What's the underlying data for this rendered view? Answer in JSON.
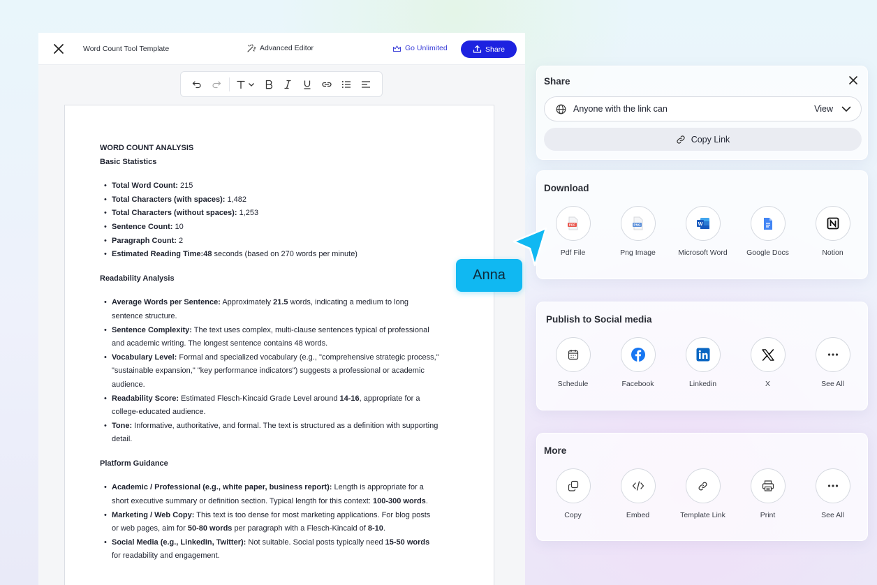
{
  "editor": {
    "doc_title": "Word Count Tool Template",
    "advanced_editor": "Advanced Editor",
    "go_unlimited": "Go Unlimited",
    "share": "Share"
  },
  "doc": {
    "title": "WORD COUNT ANALYSIS",
    "s1": {
      "heading": "Basic Statistics",
      "items": [
        {
          "b": "Total Word Count:",
          "t": " 215"
        },
        {
          "b": "Total Characters (with spaces):",
          "t": " 1,482"
        },
        {
          "b": "Total Characters (without spaces):",
          "t": " 1,253"
        },
        {
          "b": "Sentence Count:",
          "t": " 10"
        },
        {
          "b": "Paragraph Count:",
          "t": " 2"
        },
        {
          "b": "Estimated Reading Time:",
          "b2": "48",
          "t": " seconds (based on 270 words per minute)"
        }
      ]
    },
    "s2": {
      "heading": "Readability Analysis",
      "items": [
        {
          "b": "Average Words per Sentence:",
          "t1": " Approximately ",
          "b2": "21.5",
          "t2": " words, indicating a medium to long sentence structure."
        },
        {
          "b": "Sentence Complexity:",
          "t": " The text uses complex, multi-clause sentences typical of professional and academic writing. The longest sentence contains 48 words."
        },
        {
          "b": "Vocabulary Level:",
          "t": " Formal and specialized vocabulary (e.g., \"comprehensive strategic process,\" \"sustainable expansion,\" \"key performance indicators\") suggests a professional or academic audience."
        },
        {
          "b": "Readability Score:",
          "t1": " Estimated Flesch-Kincaid Grade Level around ",
          "b2": "14-16",
          "t2": ", appropriate for a college-educated audience."
        },
        {
          "b": "Tone:",
          "t": " Informative, authoritative, and formal. The text is structured as a definition with supporting detail."
        }
      ]
    },
    "s3": {
      "heading": "Platform Guidance",
      "items": [
        {
          "b": "Academic / Professional (e.g., white paper, business report):",
          "t1": " Length is appropriate for a short executive summary or definition section. Typical length for this context: ",
          "b2": "100-300 words",
          "t2": "."
        },
        {
          "b": "Marketing / Web Copy:",
          "t1": " This text is too dense for most marketing applications. For blog posts or web pages, aim for ",
          "b2": "50-80 words",
          "t2": " per paragraph with a Flesch-Kincaid of ",
          "b3": "8-10",
          "t3": "."
        },
        {
          "b": "Social Media (e.g., LinkedIn, Twitter):",
          "t1": " Not suitable. Social posts typically need ",
          "b2": "15-50 words",
          "t2": " for readability and engagement."
        }
      ]
    }
  },
  "share_panel": {
    "title": "Share",
    "permission": "Anyone with the link can",
    "permission_value": "View",
    "copy_link": "Copy Link"
  },
  "download": {
    "title": "Download",
    "items": [
      {
        "label": "Pdf File",
        "icon": "pdf-icon"
      },
      {
        "label": "Png Image",
        "icon": "png-icon"
      },
      {
        "label": "Microsoft Word",
        "icon": "microsoft-word-icon"
      },
      {
        "label": "Google Docs",
        "icon": "google-docs-icon"
      },
      {
        "label": "Notion",
        "icon": "notion-icon"
      }
    ]
  },
  "social": {
    "title": "Publish to Social media",
    "items": [
      {
        "label": "Schedule",
        "icon": "calendar-icon"
      },
      {
        "label": "Facebook",
        "icon": "facebook-icon"
      },
      {
        "label": "Linkedin",
        "icon": "linkedin-icon"
      },
      {
        "label": "X",
        "icon": "x-logo-icon"
      },
      {
        "label": "See All",
        "icon": "more-icon"
      }
    ]
  },
  "more": {
    "title": "More",
    "items": [
      {
        "label": "Copy",
        "icon": "copy-icon"
      },
      {
        "label": "Embed",
        "icon": "code-icon"
      },
      {
        "label": "Template Link",
        "icon": "link-icon"
      },
      {
        "label": "Print",
        "icon": "printer-icon"
      },
      {
        "label": "See All",
        "icon": "more-icon"
      }
    ]
  },
  "cursor_label": "Anna",
  "colors": {
    "primary": "#1d22e0",
    "cursor": "#10b8f2",
    "pdf": "#e8584f",
    "word": "#185abd",
    "gdocs": "#4285f4",
    "facebook": "#1877f2",
    "linkedin": "#0a66c2"
  }
}
